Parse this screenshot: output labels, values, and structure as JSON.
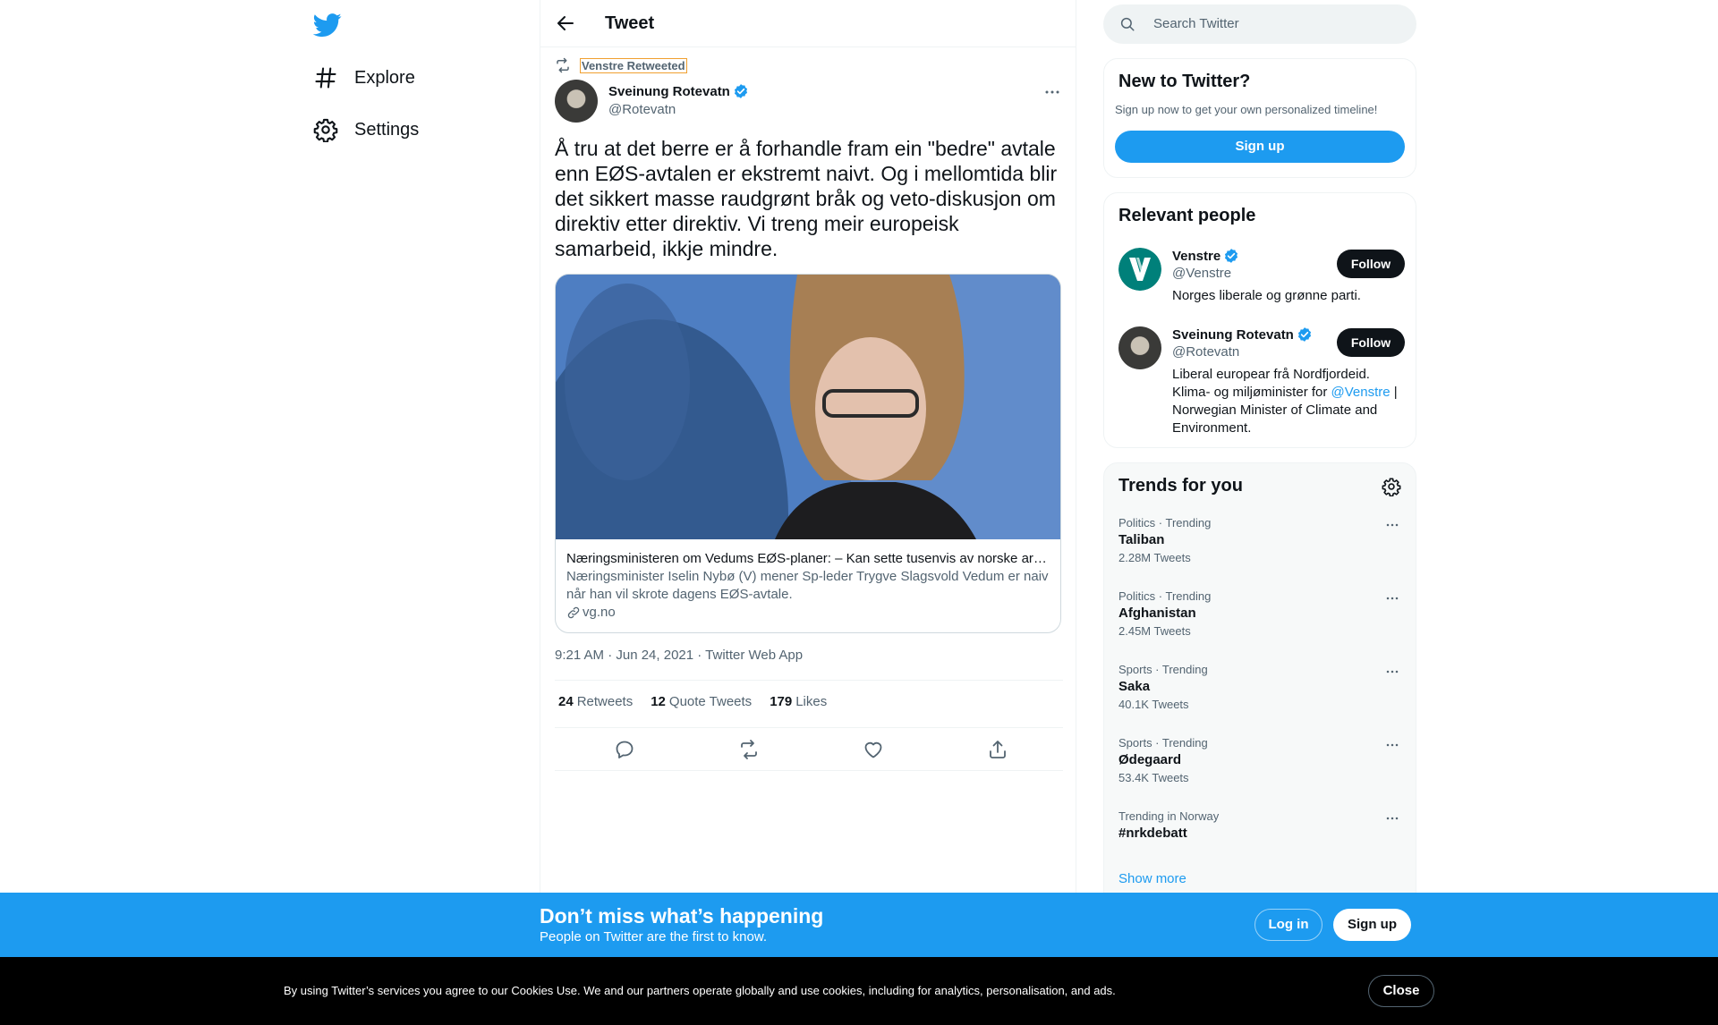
{
  "nav": {
    "items": [
      {
        "label": "Explore",
        "icon": "hashtag-icon"
      },
      {
        "label": "Settings",
        "icon": "gear-icon"
      }
    ]
  },
  "header": {
    "title": "Tweet"
  },
  "tweet": {
    "social_context": "Venstre Retweeted",
    "author_name": "Sveinung Rotevatn",
    "author_handle": "@Rotevatn",
    "text": "Å tru at det berre er å forhandle fram ein \"bedre\" avtale enn EØS-avtalen er ekstremt naivt. Og i mellomtida blir det sikkert masse raudgrønt bråk og veto-diskusjon om direktiv etter direktiv. Vi treng meir europeisk samarbeid, ikkje mindre.",
    "card": {
      "title": "Næringsministeren om Vedums EØS-planer: – Kan sette tusenvis av norske arbe…",
      "description": "Næringsminister Iselin Nybø (V) mener Sp-leder Trygve Slagsvold Vedum er naiv når han vil skrote dagens EØS-avtale.",
      "domain": "vg.no"
    },
    "meta": "9:21 AM · Jun 24, 2021 · Twitter Web App",
    "stats": [
      {
        "count": "24",
        "label": "Retweets"
      },
      {
        "count": "12",
        "label": "Quote Tweets"
      },
      {
        "count": "179",
        "label": "Likes"
      }
    ]
  },
  "search": {
    "placeholder": "Search Twitter"
  },
  "new_to_twitter": {
    "title": "New to Twitter?",
    "subtitle": "Sign up now to get your own personalized timeline!",
    "signup_label": "Sign up"
  },
  "relevant_people": {
    "title": "Relevant people",
    "people": [
      {
        "name": "Venstre",
        "handle": "@Venstre",
        "bio": "Norges liberale og grønne parti.",
        "follow_label": "Follow"
      },
      {
        "name": "Sveinung Rotevatn",
        "handle": "@Rotevatn",
        "bio_before": "Liberal europear frå Nordfjordeid. Klima- og miljøminister for ",
        "bio_mention": "@Venstre",
        "bio_after": " | Norwegian Minister of Climate and Environment.",
        "follow_label": "Follow"
      }
    ]
  },
  "trends": {
    "title": "Trends for you",
    "items": [
      {
        "context": "Politics · Trending",
        "name": "Taliban",
        "count": "2.28M Tweets"
      },
      {
        "context": "Politics · Trending",
        "name": "Afghanistan",
        "count": "2.45M Tweets"
      },
      {
        "context": "Sports · Trending",
        "name": "Saka",
        "count": "40.1K Tweets"
      },
      {
        "context": "Sports · Trending",
        "name": "Ødegaard",
        "count": "53.4K Tweets"
      },
      {
        "context": "Trending in Norway",
        "name": "#nrkdebatt",
        "count": ""
      }
    ],
    "show_more": "Show more"
  },
  "banner": {
    "title": "Don’t miss what’s happening",
    "subtitle": "People on Twitter are the first to know.",
    "login_label": "Log in",
    "signup_label": "Sign up"
  },
  "cookies": {
    "text": "By using Twitter’s services you agree to our Cookies Use. We and our partners operate globally and use cookies, including for analytics, personalisation, and ads.",
    "close_label": "Close"
  },
  "colors": {
    "accent": "#1d9bf0",
    "text": "#0f1419",
    "muted": "#536471"
  }
}
